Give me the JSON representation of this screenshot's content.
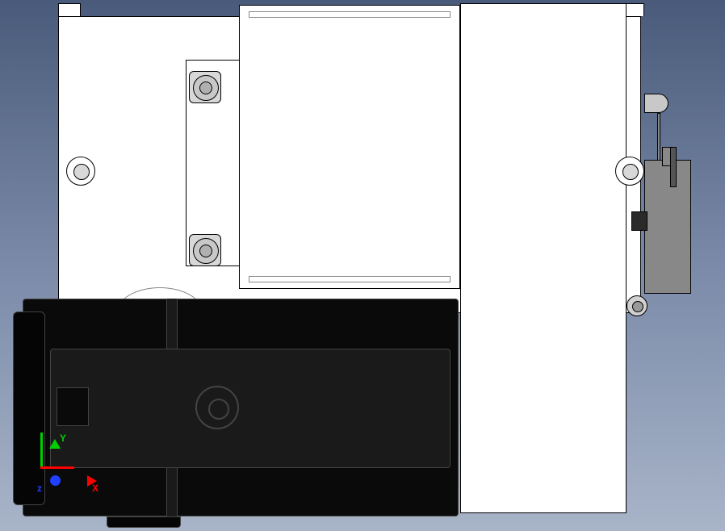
{
  "view": {
    "triad": {
      "x_label": "X",
      "y_label": "Y",
      "z_label": "z",
      "x_color": "#ff0000",
      "y_color": "#00d000",
      "z_color": "#2040ff"
    }
  },
  "colors": {
    "background_top": "#4a5a7a",
    "background_bottom": "#a8b4c8",
    "housing": "#ffffff",
    "metal_gray": "#888888",
    "motor_black": "#0a0a0a"
  }
}
